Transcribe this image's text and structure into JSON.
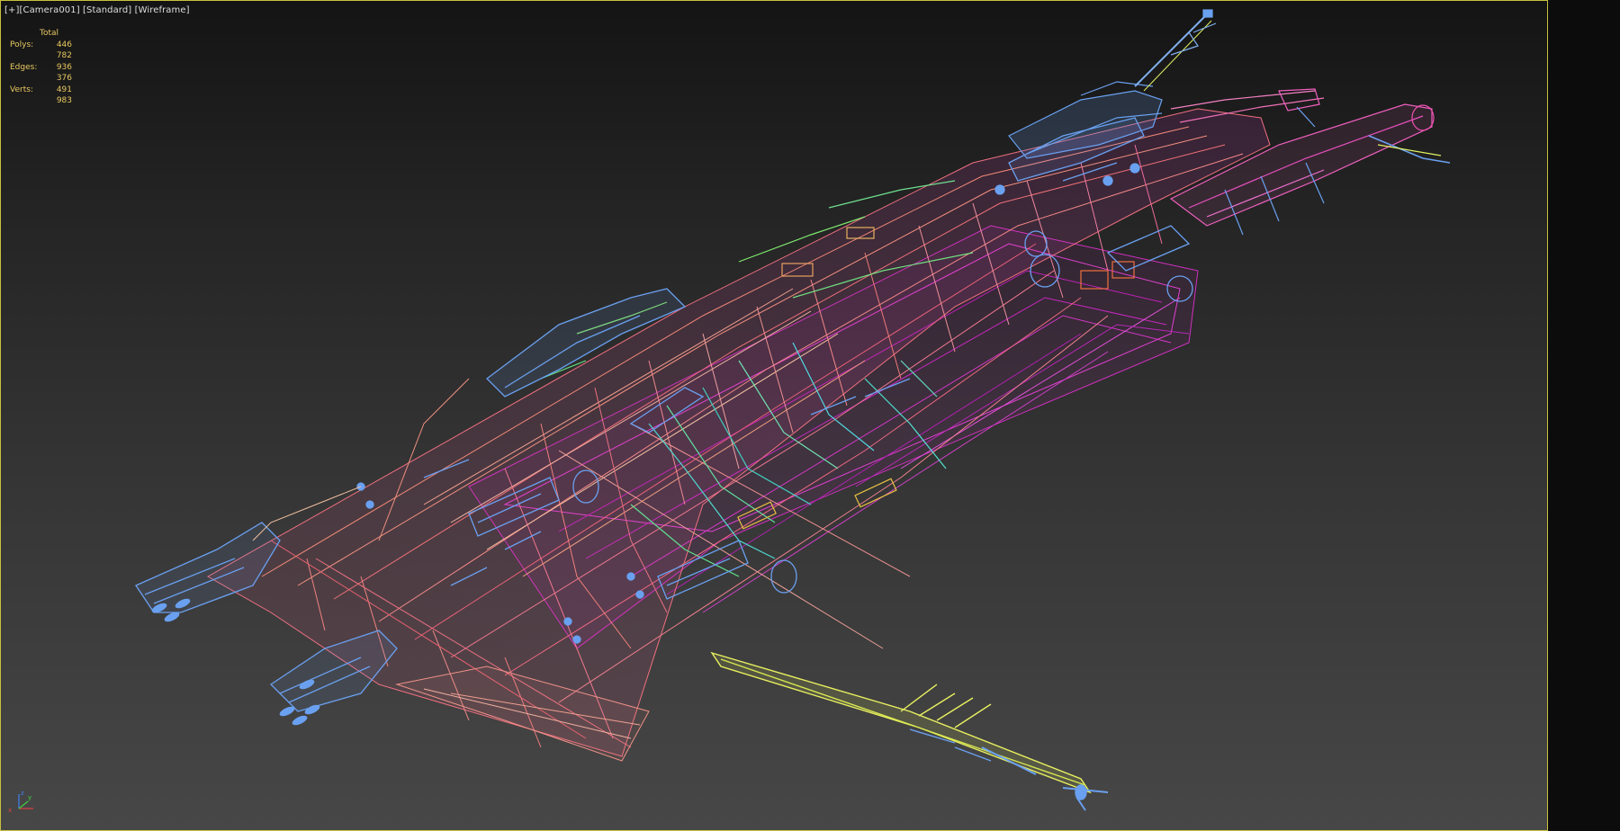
{
  "viewport": {
    "label_plus": "[+]",
    "label_camera": "[Camera001]",
    "label_shading": "[Standard]",
    "label_mode": "[Wireframe]"
  },
  "stats": {
    "header": "Total",
    "rows": [
      {
        "label": "Polys:",
        "value": "446 782"
      },
      {
        "label": "Edges:",
        "value": "936 376"
      },
      {
        "label": "Verts:",
        "value": "491 983"
      }
    ]
  },
  "gizmo": {
    "x_label": "x",
    "y_label": "y",
    "z_label": "z"
  },
  "colors": {
    "frame_border": "#c8c040",
    "stats_text": "#e8c860",
    "wire_magenta": "#e040d0",
    "wire_pink": "#f06080",
    "wire_salmon": "#f08070",
    "wire_blue": "#6aa0f0",
    "wire_green": "#60e080",
    "wire_yellow": "#e8f060",
    "wire_cyan": "#60e0e0"
  }
}
